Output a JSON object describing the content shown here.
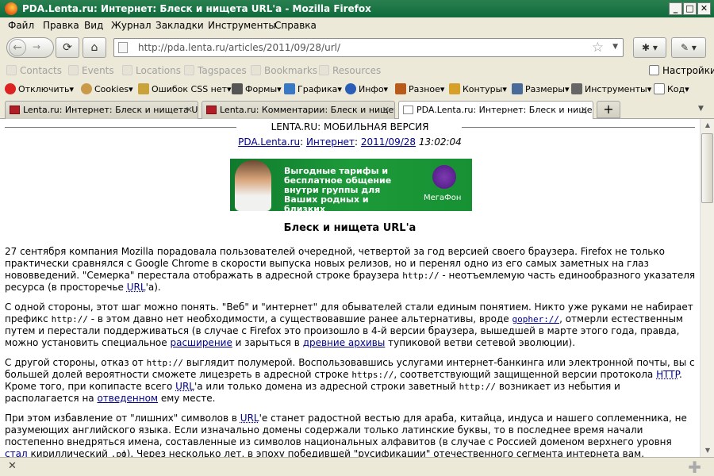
{
  "window": {
    "title": "PDA.Lenta.ru: Интернет: Блеск и нищета URL'а - Mozilla Firefox",
    "min": "_",
    "max": "□",
    "close": "✕"
  },
  "menu": [
    "Файл",
    "Правка",
    "Вид",
    "Журнал",
    "Закладки",
    "Инструменты",
    "Справка"
  ],
  "nav": {
    "url": "http://pda.lenta.ru/articles/2011/09/28/url/"
  },
  "bookmarks": {
    "items": [
      "Contacts",
      "Events",
      "Locations",
      "Tagspaces",
      "Bookmarks",
      "Resources"
    ],
    "settings": "Настройки"
  },
  "devbar": [
    "Отключить▾",
    "Cookies▾",
    "Ошибок CSS нет▾",
    "Формы▾",
    "Графика▾",
    "Инфо▾",
    "Разное▾",
    "Контуры▾",
    "Размеры▾",
    "Инструменты▾",
    "Код▾"
  ],
  "tabs": [
    {
      "label": "Lenta.ru: Интернет: Блеск и нищета U..."
    },
    {
      "label": "Lenta.ru: Комментарии: Блеск и нищет..."
    },
    {
      "label": "PDA.Lenta.ru: Интернет: Блеск и нище..."
    }
  ],
  "page": {
    "header": "LENTA.RU: МОБИЛЬНАЯ ВЕРСИЯ",
    "site": "PDA.Lenta.ru",
    "sep": ":",
    "section": "Интернет",
    "date": "2011/09/28",
    "time": "13:02:04",
    "banner": {
      "text": "Выгодные тарифы и бесплатное общение внутри группы для Ваших родных и близких",
      "brand": "МегаФон"
    },
    "title": "Блеск и нищета URL'а",
    "p1": [
      "27 сентября компания Mozilla порадовала пользователей очередной, четвертой за год версией своего браузера. Firefox не только практически сравнялся с Google Chrome в скорости выпуска новых релизов, но и перенял одно из его самых заметных на глаз нововведений. \"Семерка\" перестала отображать в адресной строке браузера ",
      "http://",
      " - неотъемлемую часть единообразного указателя ресурса (в просторечье ",
      "URL",
      "'а)."
    ],
    "p2": [
      "С одной стороны, этот шаг можно понять. \"Веб\" и \"интернет\" для обывателей стали единым понятием. Никто уже руками не набирает префикс ",
      "http://",
      " - в этом давно нет необходимости, а существовавшие ранее альтернативы, вроде ",
      "gopher://",
      ", отмерли естественным путем и перестали поддерживаться (в случае с Firefox это произошло в 4-й версии браузера, вышедшей в марте этого года, правда, можно установить специальное ",
      "расширение",
      " и зарыться в ",
      "древние архивы",
      " тупиковой ветви сетевой эволюции)."
    ],
    "p3": [
      "С другой стороны, отказ от ",
      "http://",
      " выглядит полумерой. Воспользовавшись услугами интернет-банкинга или электронной почты, вы с большей долей вероятности сможете лицезреть в адресной строке ",
      "https://",
      ", соответствующий защищенной версии протокола ",
      "HTTP",
      ". Кроме того, при копипасте всего ",
      "URL",
      "'а или только домена из адресной строки заветный ",
      "http://",
      " возникает из небытия и располагается на ",
      "отведенном",
      " ему месте."
    ],
    "p4": [
      "При этом избавление от \"лишних\" символов в ",
      "URL",
      "'е станет радостной вестью для араба, китайца, индуса и нашего соплеменника, не разумеющих английского языка. Если изначально домены содержали только латинские буквы, то в последнее время начали постепенно внедряться имена, составленные из символов национальных алфавитов (в случае с Россией доменом верхнего уровня ",
      "стал",
      " кириллический ",
      ".рф",
      "). Через несколько лет, в эпоху победившей \"русификации\" отечественного сегмента интернета вам,"
    ]
  }
}
